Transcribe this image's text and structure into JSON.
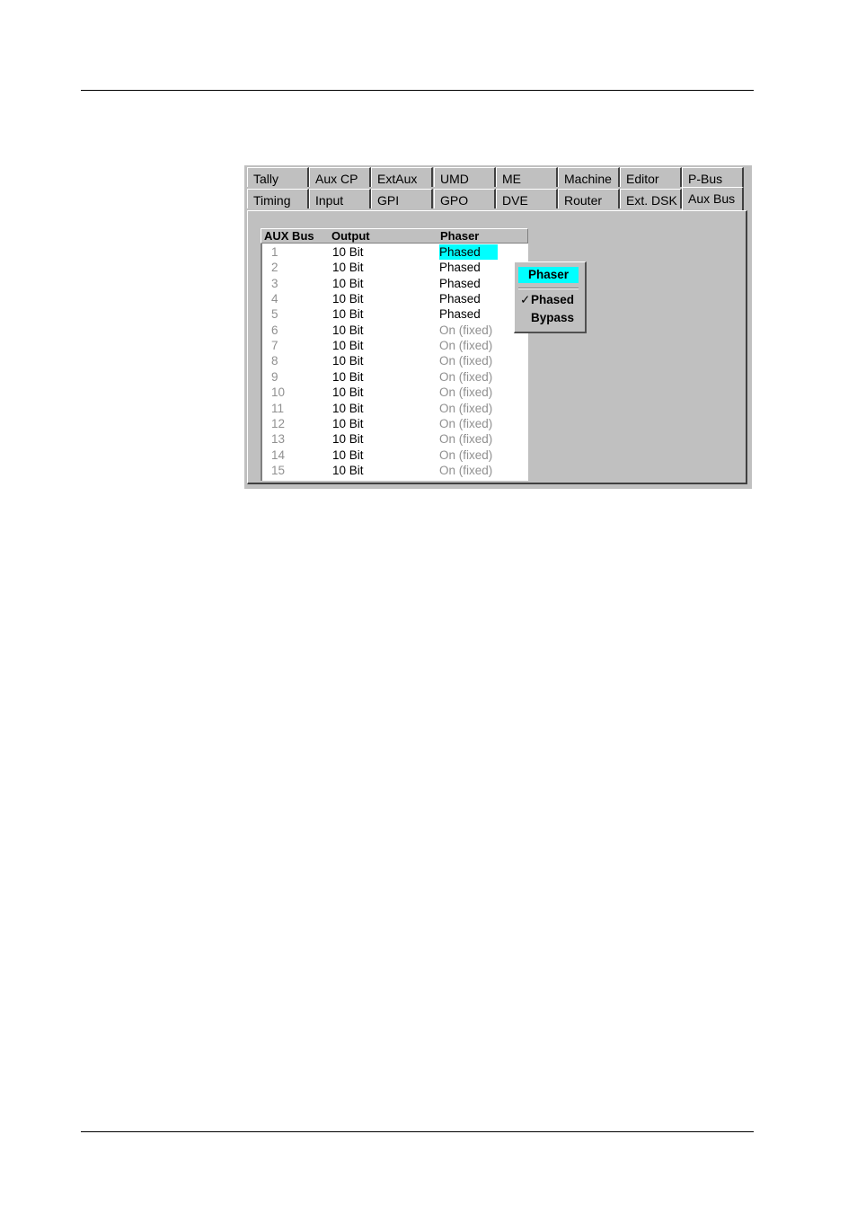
{
  "tabs": {
    "row_top": [
      {
        "label": "Tally"
      },
      {
        "label": "Aux CP"
      },
      {
        "label": "ExtAux"
      },
      {
        "label": "UMD"
      },
      {
        "label": "ME"
      },
      {
        "label": "Machine"
      },
      {
        "label": "Editor"
      },
      {
        "label": "P-Bus"
      }
    ],
    "row_bottom": [
      {
        "label": "Timing"
      },
      {
        "label": "Input"
      },
      {
        "label": "GPI"
      },
      {
        "label": "GPO"
      },
      {
        "label": "DVE"
      },
      {
        "label": "Router"
      },
      {
        "label": "Ext. DSK"
      },
      {
        "label": "Aux Bus"
      }
    ],
    "selected": "Aux Bus"
  },
  "table": {
    "headers": {
      "bus": "AUX Bus",
      "output": "Output",
      "phaser": "Phaser"
    },
    "rows": [
      {
        "bus": "1",
        "output": "10 Bit",
        "phaser": "Phased"
      },
      {
        "bus": "2",
        "output": "10 Bit",
        "phaser": "Phased"
      },
      {
        "bus": "3",
        "output": "10 Bit",
        "phaser": "Phased"
      },
      {
        "bus": "4",
        "output": "10 Bit",
        "phaser": "Phased"
      },
      {
        "bus": "5",
        "output": "10 Bit",
        "phaser": "Phased"
      },
      {
        "bus": "6",
        "output": "10 Bit",
        "phaser": "On (fixed)"
      },
      {
        "bus": "7",
        "output": "10 Bit",
        "phaser": "On (fixed)"
      },
      {
        "bus": "8",
        "output": "10 Bit",
        "phaser": "On (fixed)"
      },
      {
        "bus": "9",
        "output": "10 Bit",
        "phaser": "On (fixed)"
      },
      {
        "bus": "10",
        "output": "10 Bit",
        "phaser": "On (fixed)"
      },
      {
        "bus": "11",
        "output": "10 Bit",
        "phaser": "On (fixed)"
      },
      {
        "bus": "12",
        "output": "10 Bit",
        "phaser": "On (fixed)"
      },
      {
        "bus": "13",
        "output": "10 Bit",
        "phaser": "On (fixed)"
      },
      {
        "bus": "14",
        "output": "10 Bit",
        "phaser": "On (fixed)"
      },
      {
        "bus": "15",
        "output": "10 Bit",
        "phaser": "On (fixed)"
      }
    ],
    "highlight_color": "#00ffff"
  },
  "context_menu": {
    "title": "Phaser",
    "items": [
      {
        "label": "Phased",
        "checked": true,
        "check_glyph": "✓"
      },
      {
        "label": "Bypass",
        "checked": false,
        "check_glyph": ""
      }
    ]
  }
}
